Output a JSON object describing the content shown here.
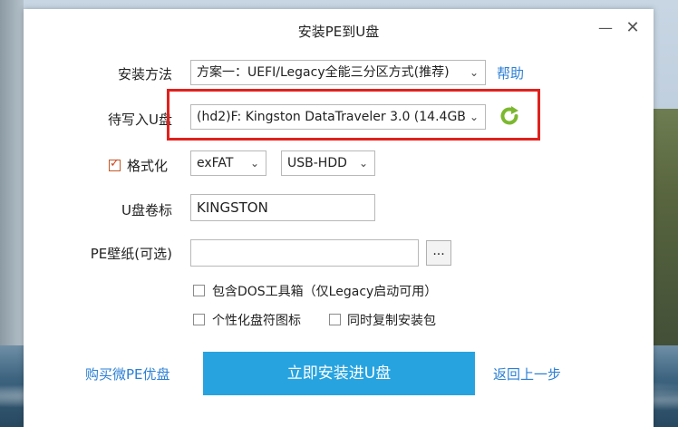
{
  "window": {
    "title": "安装PE到U盘",
    "minimize_glyph": "—",
    "close_glyph": "✕"
  },
  "install_method": {
    "label": "安装方法",
    "value": "方案一：UEFI/Legacy全能三分区方式(推荐)",
    "help_link": "帮助"
  },
  "target_drive": {
    "label": "待写入U盘",
    "value": "(hd2)F: Kingston DataTraveler 3.0 (14.4GB",
    "refresh_icon": "refresh-icon"
  },
  "format": {
    "label": "格式化",
    "checked": true,
    "filesystem": "exFAT",
    "mode": "USB-HDD"
  },
  "volume_label": {
    "label": "U盘卷标",
    "value": "KINGSTON"
  },
  "wallpaper": {
    "label": "PE壁纸(可选)",
    "value": "",
    "browse_label": "..."
  },
  "options": {
    "include_dos": "包含DOS工具箱（仅Legacy启动可用）",
    "custom_icon": "个性化盘符图标",
    "copy_package": "同时复制安装包"
  },
  "footer": {
    "buy_link": "购买微PE优盘",
    "install_button": "立即安装进U盘",
    "back_link": "返回上一步"
  },
  "colors": {
    "accent": "#27a3e0",
    "link": "#2b7fd4",
    "highlight": "#e0211d",
    "refresh": "#7cb82f"
  }
}
